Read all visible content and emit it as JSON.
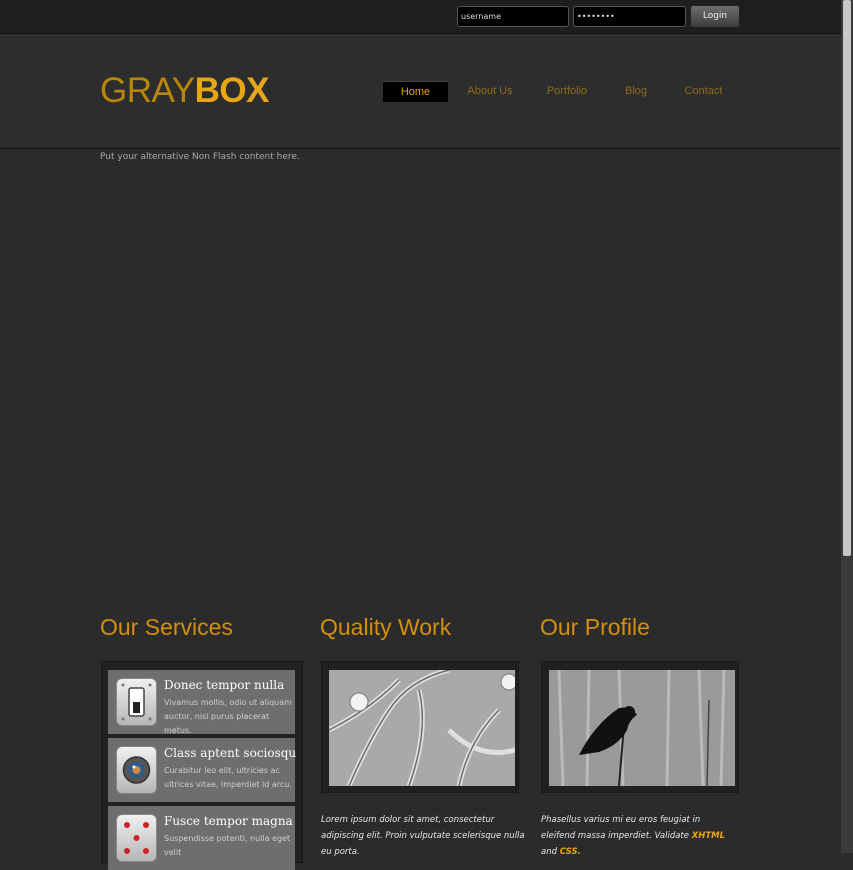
{
  "login": {
    "username_value": "username",
    "password_value": "••••••••",
    "button_label": "Login"
  },
  "logo": {
    "part1": "GRAY",
    "part2": "BOX"
  },
  "nav": {
    "items": [
      {
        "label": "Home",
        "active": true
      },
      {
        "label": "About Us"
      },
      {
        "label": "Portfolio"
      },
      {
        "label": "Blog"
      },
      {
        "label": "Contact"
      }
    ]
  },
  "alt_content": "Put your alternative Non Flash content here.",
  "sections": {
    "services": {
      "title": "Our Services",
      "items": [
        {
          "title": "Donec tempor nulla",
          "text": "Vivamus mollis, odio ut aliquam auctor, nisi purus placerat metus.",
          "icon": "switch-icon"
        },
        {
          "title": "Class aptent sociosqu",
          "text": "Curabitur leo elit, ultricies ac ultrices vitae, imperdiet id arcu.",
          "icon": "camera-icon"
        },
        {
          "title": "Fusce tempor magna",
          "text": "Suspendisse potenti, nulla eget velit",
          "icon": "dice-icon"
        }
      ]
    },
    "quality": {
      "title": "Quality Work",
      "image": "branches-with-water-drops-photo",
      "caption": "Lorem ipsum dolor sit amet, consectetur adipiscing elit. Proin vulputate scelerisque nulla eu porta."
    },
    "profile": {
      "title": "Our Profile",
      "image": "bird-on-reed-photo",
      "caption_text": "Phasellus varius mi eu eros feugiat in eleifend massa imperdiet. Validate",
      "link1": "XHTML",
      "and": "and",
      "link2": "CSS."
    }
  },
  "colors": {
    "accent": "#e8a616",
    "background": "#2b2b2b",
    "header": "#2d2d2d"
  }
}
